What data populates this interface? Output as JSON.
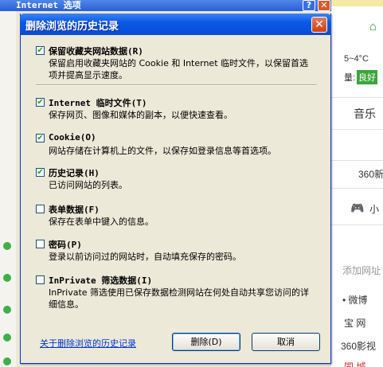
{
  "background": {
    "outer_title": "Internet 选项",
    "outer_help": "?",
    "outer_close": "✕",
    "weather": "5~4°C",
    "air_label": "量:",
    "air_badge": "良好",
    "music": "音乐",
    "site360": "360新",
    "game_text": "小",
    "add_url": "添加网址",
    "weibo": "• 微博",
    "taobao": "宝 网",
    "video": "360影视",
    "more": "国 城"
  },
  "dialog": {
    "title": "删除浏览的历史记录",
    "close_label": "✕",
    "items": [
      {
        "checked": true,
        "mark": "✔",
        "title": "保留收藏夹网站数据(R)",
        "desc": "保留启用收藏夹网站的 Cookie 和 Internet 临时文件，以保留首选项并提高显示速度。"
      },
      {
        "checked": true,
        "mark": "✔",
        "title": "Internet 临时文件(T)",
        "desc": "保存网页、图像和媒体的副本，以便快速查看。"
      },
      {
        "checked": true,
        "mark": "✔",
        "title": "Cookie(O)",
        "desc": "网站存储在计算机上的文件，以保存如登录信息等首选项。"
      },
      {
        "checked": true,
        "mark": "✔",
        "title": "历史记录(H)",
        "desc": "已访问网站的列表。"
      },
      {
        "checked": false,
        "mark": "",
        "title": "表单数据(F)",
        "desc": "保存在表单中键入的信息。"
      },
      {
        "checked": false,
        "mark": "",
        "title": "密码(P)",
        "desc": "登录以前访问过的网站时，自动填充保存的密码。"
      },
      {
        "checked": false,
        "mark": "",
        "title": "InPrivate 筛选数据(I)",
        "desc": "InPrivate 筛选使用已保存数据检测网站在何处自动共享您访问的详细信息。"
      }
    ],
    "about_link": "关于删除浏览的历史记录",
    "delete_button": "删除(D)",
    "cancel_button": "取消"
  }
}
